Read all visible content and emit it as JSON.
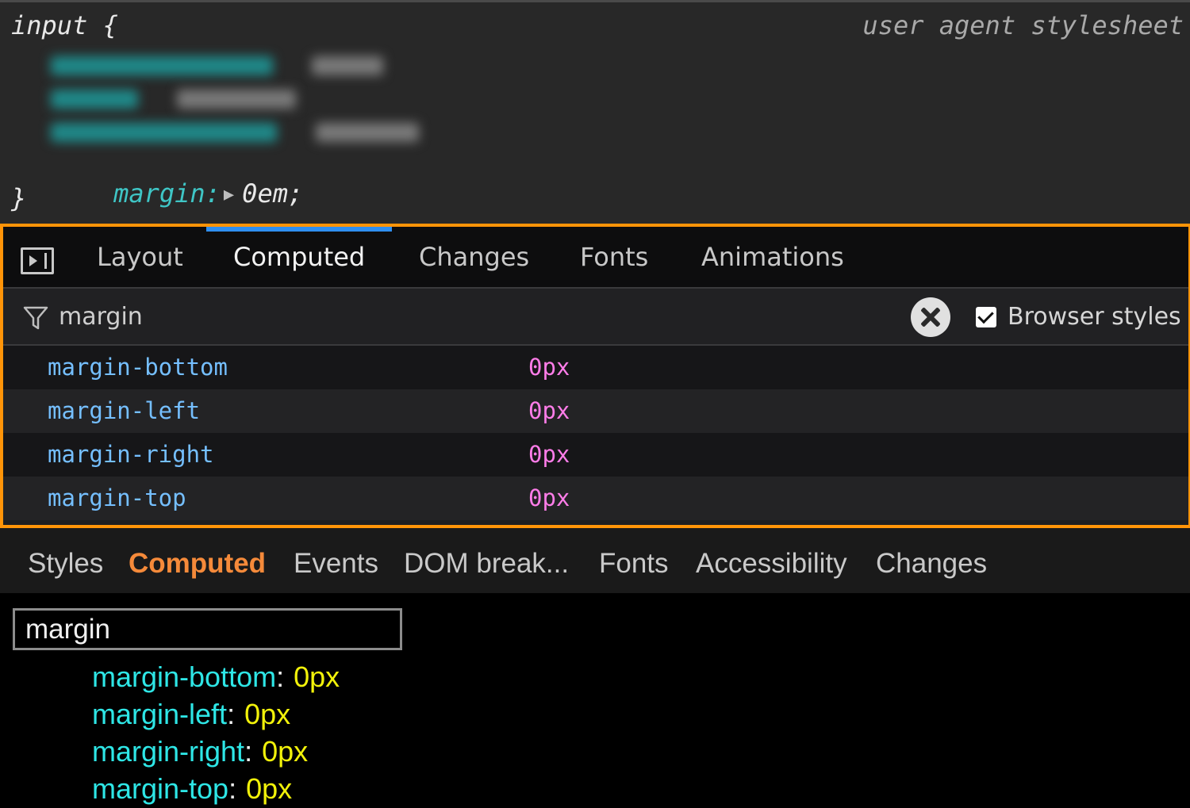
{
  "rule_panel": {
    "selector": "input {",
    "origin": "user agent stylesheet",
    "declaration_property": "margin:",
    "declaration_value": "0em;",
    "closing_brace": "}"
  },
  "ff_panel": {
    "tabs": [
      "Layout",
      "Computed",
      "Changes",
      "Fonts",
      "Animations"
    ],
    "active_tab": "Computed",
    "filter_value": "margin",
    "browser_styles_label": "Browser styles",
    "browser_styles_checked": true,
    "rows": [
      {
        "name": "margin-bottom",
        "value": "0px"
      },
      {
        "name": "margin-left",
        "value": "0px"
      },
      {
        "name": "margin-right",
        "value": "0px"
      },
      {
        "name": "margin-top",
        "value": "0px"
      }
    ]
  },
  "edge_panel": {
    "tabs": [
      "Styles",
      "Computed",
      "Events",
      "DOM break...",
      "Fonts",
      "Accessibility",
      "Changes"
    ],
    "active_tab": "Computed",
    "search_value": "margin",
    "rows": [
      {
        "name": "margin-bottom",
        "value": "0px"
      },
      {
        "name": "margin-left",
        "value": "0px"
      },
      {
        "name": "margin-right",
        "value": "0px"
      },
      {
        "name": "margin-top",
        "value": "0px"
      }
    ]
  },
  "colors": {
    "highlight_border": "#ff9408",
    "ff_active_tab_indicator": "#2f8ff0",
    "ff_property_name": "#75bfff",
    "ff_property_value": "#ff7de9",
    "edge_active_tab": "#f58a3a",
    "edge_property_name": "#2ee6e6",
    "edge_property_value": "#f2f20a"
  }
}
